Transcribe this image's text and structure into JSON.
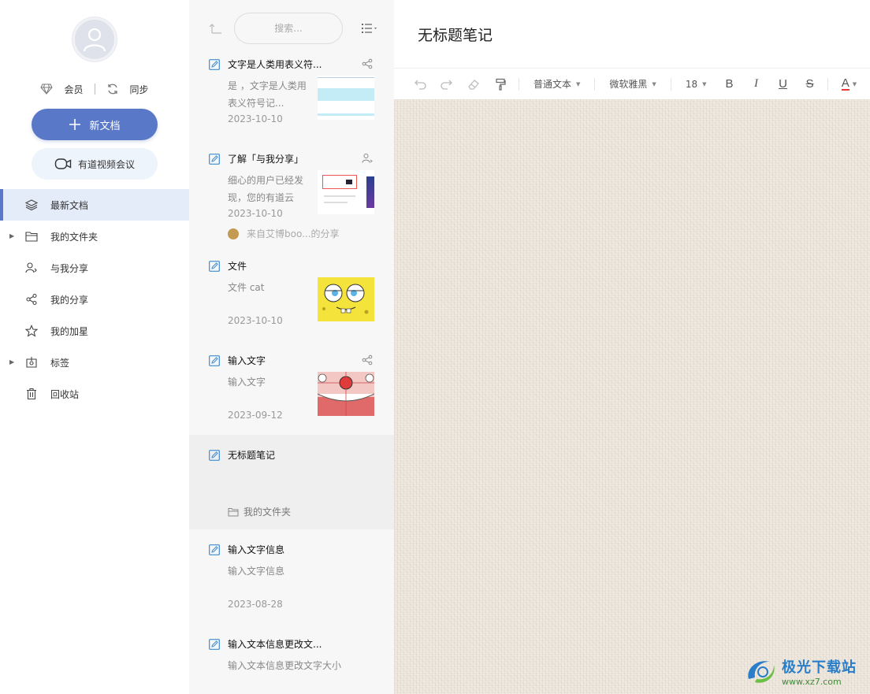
{
  "sidebar": {
    "member_label": "会员",
    "sync_label": "同步",
    "new_doc_label": "新文档",
    "meeting_label": "有道视频会议",
    "nav": [
      {
        "label": "最新文档",
        "icon": "layers-icon",
        "active": true,
        "caret": false
      },
      {
        "label": "我的文件夹",
        "icon": "folder-icon",
        "active": false,
        "caret": true
      },
      {
        "label": "与我分享",
        "icon": "shared-with-me-icon",
        "active": false,
        "caret": false
      },
      {
        "label": "我的分享",
        "icon": "share-icon",
        "active": false,
        "caret": false
      },
      {
        "label": "我的加星",
        "icon": "star-icon",
        "active": false,
        "caret": false
      },
      {
        "label": "标签",
        "icon": "tag-icon",
        "active": false,
        "caret": true
      },
      {
        "label": "回收站",
        "icon": "trash-icon",
        "active": false,
        "caret": false
      }
    ]
  },
  "list": {
    "search_placeholder": "搜索...",
    "docs": [
      {
        "title": "文字是人类用表义符...",
        "snippet": "是 ，文字是人类用表义符号记...",
        "date": "2023-10-10",
        "badge": "share-icon",
        "thumb": "cyan-stripes"
      },
      {
        "title": "了解「与我分享」",
        "snippet": "细心的用户已经发现，您的有道云笔...",
        "date": "2023-10-10",
        "badge": "shared-user-icon",
        "thumb": "screenshot",
        "from": "来自艾博boo...的分享"
      },
      {
        "title": "文件",
        "snippet": "文件 cat",
        "date": "2023-10-10",
        "thumb": "spongebob"
      },
      {
        "title": "输入文字",
        "snippet": "输入文字",
        "date": "2023-09-12",
        "badge": "share-icon",
        "thumb": "patrick"
      },
      {
        "title": "无标题笔记",
        "snippet": "",
        "date": "",
        "folder": "我的文件夹",
        "selected": true
      },
      {
        "title": "输入文字信息",
        "snippet": "输入文字信息",
        "date": "2023-08-28"
      },
      {
        "title": "输入文本信息更改文...",
        "snippet": "输入文本信息更改文字大小",
        "date": ""
      }
    ]
  },
  "editor": {
    "title": "无标题笔记",
    "toolbar": {
      "paragraph_style": "普通文本",
      "font_family": "微软雅黑",
      "font_size": "18",
      "bold": "B",
      "italic": "I",
      "underline": "U",
      "strike": "S",
      "font_color": "A"
    }
  },
  "watermark": {
    "name": "极光下载站",
    "url": "www.xz7.com"
  },
  "colors": {
    "accent": "#5a78c8",
    "nav_active_bg": "#e4ebf9",
    "meeting_bg": "#eef4fb",
    "list_bg": "#f7f7f7",
    "canvas_bg": "#ede6dc"
  }
}
